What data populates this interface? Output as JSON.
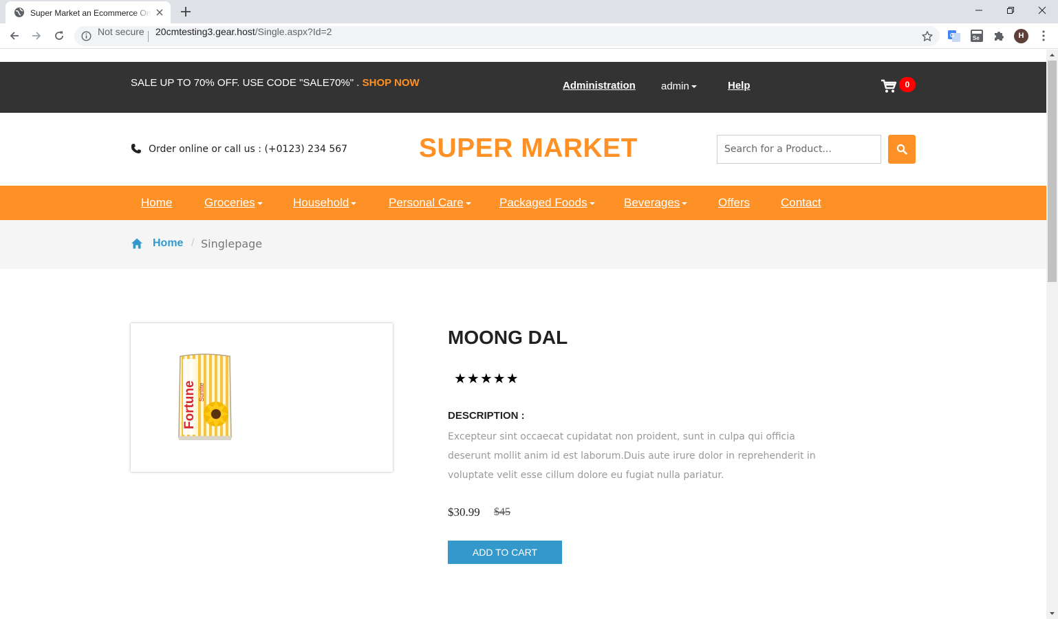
{
  "browser": {
    "tab_title": "Super Market an Ecommerce Online Shopping",
    "security_label": "Not secure",
    "url_host": "20cmtesting3.gear.host",
    "url_path": "/Single.aspx?Id=2",
    "profile_initial": "H"
  },
  "topbar": {
    "promo_text": "SALE UP TO 70% OFF. USE CODE \"SALE70%\" . ",
    "promo_link": "SHOP NOW",
    "admin_link": "Administration",
    "user_menu": "admin",
    "help_link": "Help",
    "cart_count": "0"
  },
  "header": {
    "phone_text": "Order online or call us : (+0123) 234 567",
    "logo": "SUPER MARKET",
    "search_placeholder": "Search for a Product..."
  },
  "nav": {
    "items": [
      "Home",
      "Groceries",
      "Household",
      "Personal Care",
      "Packaged Foods",
      "Beverages",
      "Offers",
      "Contact"
    ]
  },
  "breadcrumb": {
    "home": "Home",
    "separator": "/",
    "current": "Singlepage"
  },
  "product": {
    "name": "MOONG DAL",
    "rating_stars": "★★★★★",
    "rating": 5,
    "description_title": "DESCRIPTION :",
    "description": "Excepteur sint occaecat cupidatat non proident, sunt in culpa qui officia deserunt mollit anim id est laborum.Duis aute irure dolor in reprehenderit in voluptate velit esse cillum dolore eu fugiat nulla pariatur.",
    "price": "$30.99",
    "old_price": "$45",
    "add_to_cart": "ADD TO CART",
    "image_brand_text": "Fortune",
    "image_sub_text": "Sunlite"
  },
  "colors": {
    "accent": "#fe9126",
    "dark_bar": "#333333",
    "link_blue": "#3399cc",
    "badge_red": "#ff0000"
  }
}
